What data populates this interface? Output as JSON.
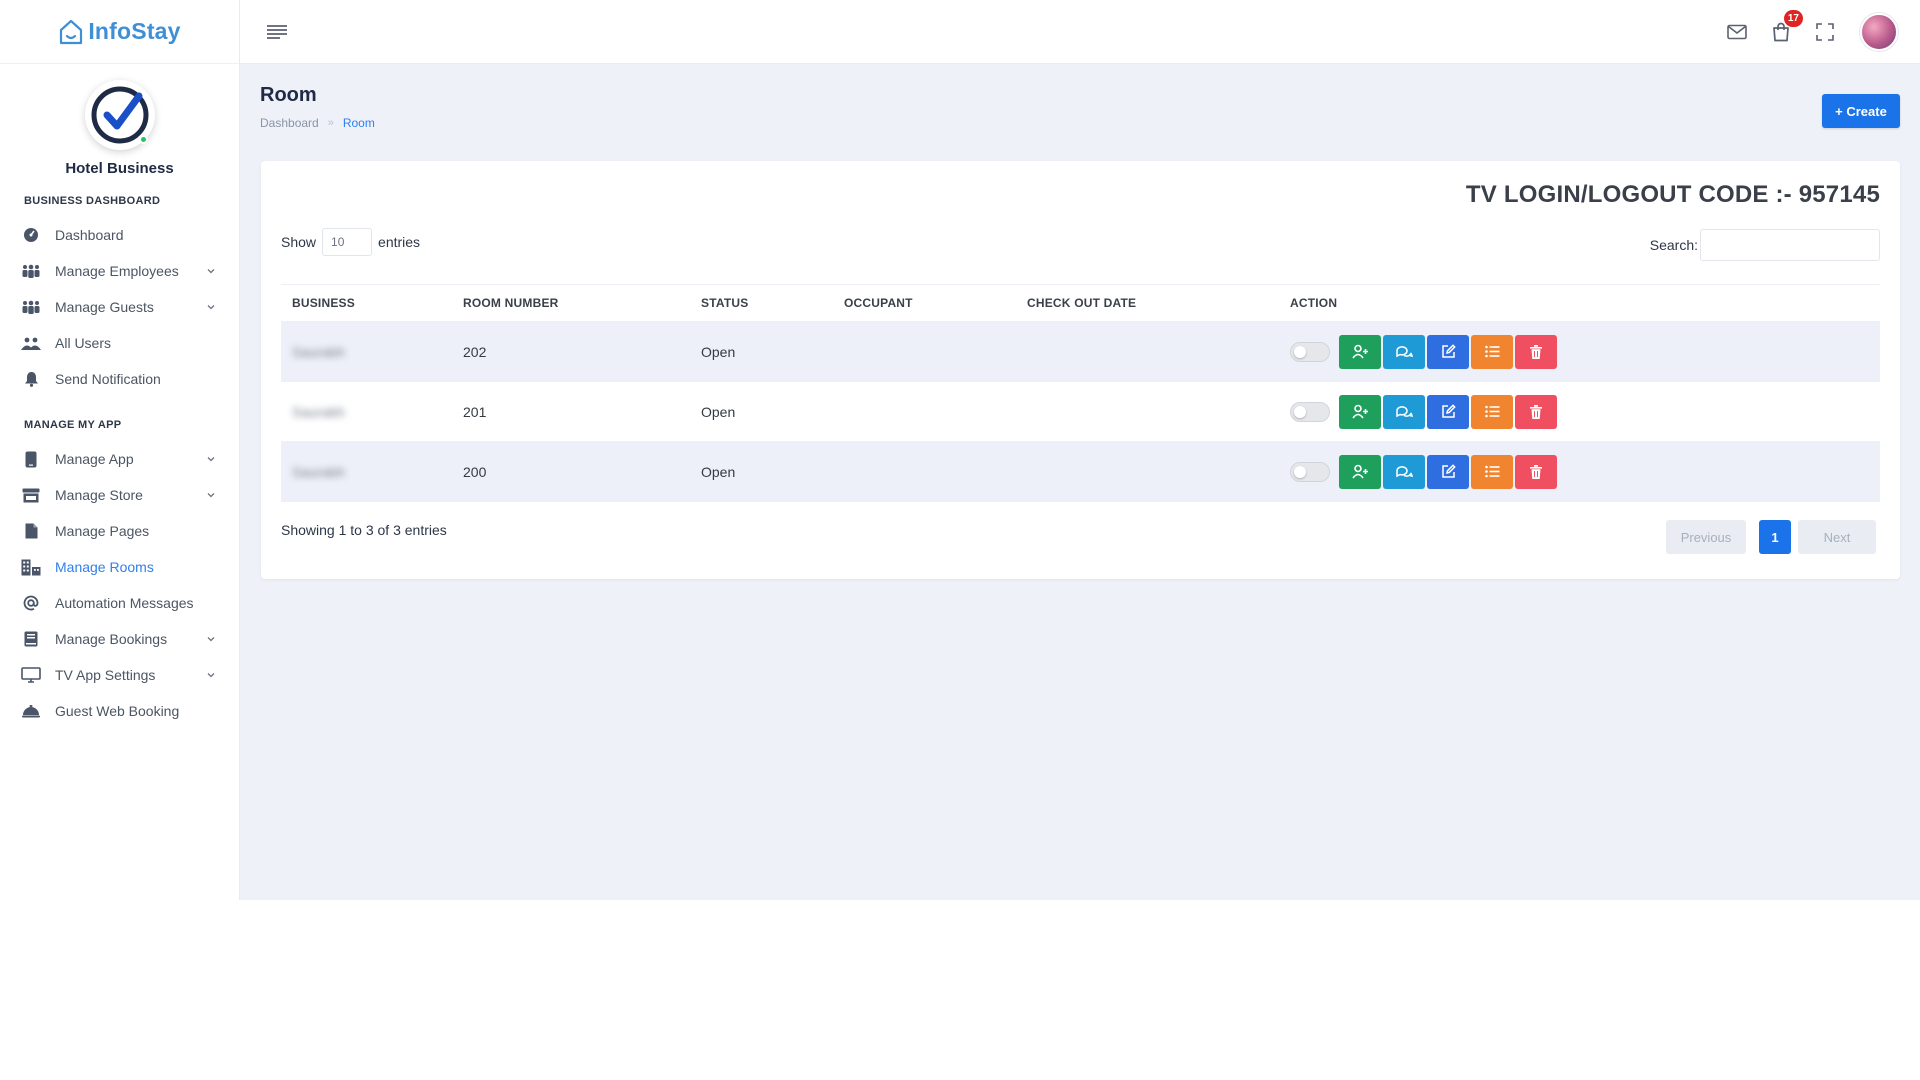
{
  "brand": {
    "name": "InfoStay"
  },
  "profile": {
    "business_name": "Hotel Business"
  },
  "sidebar": {
    "sections": [
      {
        "title": "BUSINESS DASHBOARD",
        "items": [
          {
            "label": "Dashboard",
            "icon": "dashboard-icon",
            "has_chevron": false
          },
          {
            "label": "Manage Employees",
            "icon": "users-group-icon",
            "has_chevron": true
          },
          {
            "label": "Manage Guests",
            "icon": "users-group-icon",
            "has_chevron": true
          },
          {
            "label": "All Users",
            "icon": "users-icon",
            "has_chevron": false
          },
          {
            "label": "Send Notification",
            "icon": "bell-icon",
            "has_chevron": false
          }
        ]
      },
      {
        "title": "MANAGE MY APP",
        "items": [
          {
            "label": "Manage App",
            "icon": "mobile-icon",
            "has_chevron": true
          },
          {
            "label": "Manage Store",
            "icon": "store-icon",
            "has_chevron": true
          },
          {
            "label": "Manage Pages",
            "icon": "file-icon",
            "has_chevron": false
          },
          {
            "label": "Manage Rooms",
            "icon": "building-icon",
            "has_chevron": false,
            "active": true
          },
          {
            "label": "Automation Messages",
            "icon": "at-icon",
            "has_chevron": false
          },
          {
            "label": "Manage Bookings",
            "icon": "book-icon",
            "has_chevron": true
          },
          {
            "label": "TV App Settings",
            "icon": "monitor-icon",
            "has_chevron": true
          },
          {
            "label": "Guest Web Booking",
            "icon": "bell-service-icon",
            "has_chevron": false
          }
        ]
      }
    ]
  },
  "topbar": {
    "cart_badge": "17"
  },
  "page": {
    "title": "Room",
    "breadcrumb": [
      "Dashboard",
      "Room"
    ],
    "create_label": "+ Create"
  },
  "card": {
    "tv_code_label": "TV LOGIN/LOGOUT CODE :- 957145",
    "show_label": "Show",
    "entries_value": "10",
    "entries_label": "entries",
    "search_label": "Search:",
    "search_value": "",
    "columns": [
      "BUSINESS",
      "ROOM NUMBER",
      "STATUS",
      "OCCUPANT",
      "CHECK OUT DATE",
      "ACTION"
    ],
    "rows": [
      {
        "business": "Saurabh",
        "room_number": "202",
        "status": "Open",
        "occupant": "",
        "check_out_date": ""
      },
      {
        "business": "Saurabh",
        "room_number": "201",
        "status": "Open",
        "occupant": "",
        "check_out_date": ""
      },
      {
        "business": "Saurabh",
        "room_number": "200",
        "status": "Open",
        "occupant": "",
        "check_out_date": ""
      }
    ],
    "info_text": "Showing 1 to 3 of 3 entries",
    "pagination": {
      "previous": "Previous",
      "current": "1",
      "next": "Next"
    }
  },
  "colors": {
    "accent": "#1a73e8",
    "brand": "#3f8fd6",
    "assign_button": "#1e9f5c",
    "chat_button": "#1e9bd7",
    "edit_button": "#2f6ee0",
    "list_button": "#f0842f",
    "delete_button": "#ef4f61"
  }
}
